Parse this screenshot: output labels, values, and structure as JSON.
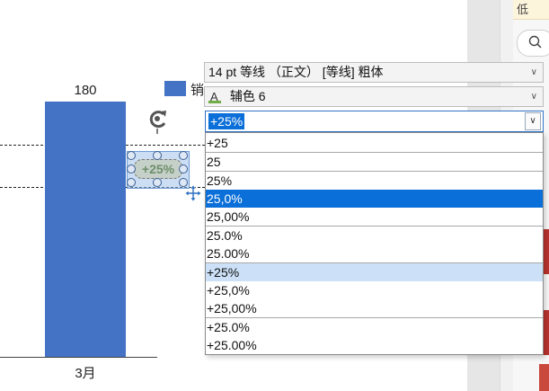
{
  "chart": {
    "bar_value_label": "180",
    "category_label": "3月",
    "legend_text": "销"
  },
  "textbox": {
    "text": "+25%"
  },
  "toolbar": {
    "font_row": "14 pt 等线 （正文） [等线] 粗体",
    "color_row": "辅色 6",
    "number_format_value": "+25%"
  },
  "dropdown": {
    "options": [
      "+25",
      "25",
      "25%",
      "25,0%",
      "25,00%",
      "25.0%",
      "25.00%",
      "+25%",
      "+25,0%",
      "+25,00%",
      "+25.0%",
      "+25.00%"
    ],
    "selected_option": "25,0%",
    "hovered_option": "+25%"
  },
  "side_panel": {
    "top_text": "低"
  },
  "colors": {
    "bar": "#4472c4",
    "accent_green": "#70ad47",
    "selection_blue": "#0a6fd8",
    "hover_blue": "#cce1f7"
  }
}
